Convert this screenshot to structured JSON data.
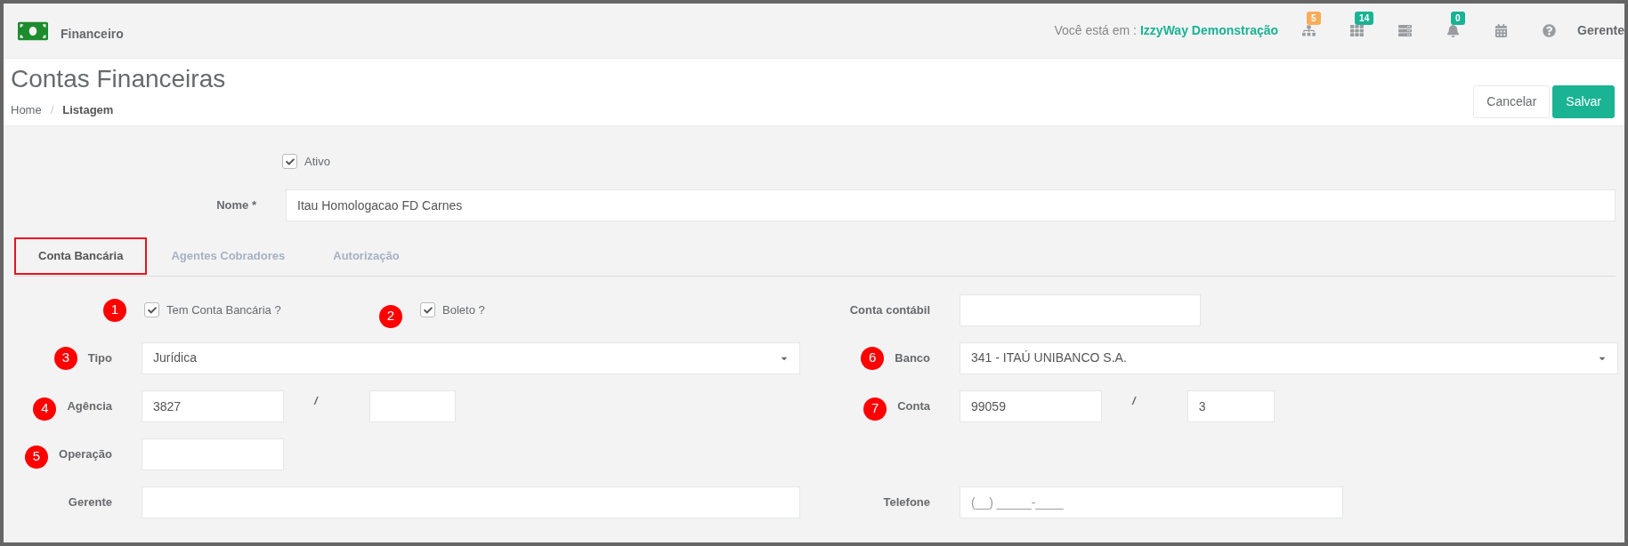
{
  "header": {
    "title": "Financeiro",
    "location_label": "Você está em :",
    "location": "IzzyWay Demonstração",
    "icons": [
      {
        "kind": "sitemap",
        "badge": "5",
        "color": "#f8ac59"
      },
      {
        "kind": "grid",
        "badge": "14",
        "color": "#1ab394"
      },
      {
        "kind": "server"
      },
      {
        "kind": "bell",
        "badge": "0",
        "color": "#1ab394"
      },
      {
        "kind": "calendar"
      },
      {
        "kind": "help"
      }
    ],
    "user": "Gerente"
  },
  "page": {
    "title": "Contas Financeiras",
    "breadcrumb": [
      "Home",
      "Listagem"
    ],
    "breadcrumb_separator": "/",
    "buttons": [
      {
        "label": "Cancelar",
        "kind": "default"
      },
      {
        "label": "Salvar",
        "kind": "primary"
      }
    ]
  },
  "form": {
    "active": {
      "label": "Ativo",
      "checked": true
    },
    "name": {
      "label": "Nome *",
      "value": "Itau Homologacao FD Carnes"
    }
  },
  "tabs": [
    {
      "label": "Conta Bancária",
      "selected": true,
      "highlighted": true
    },
    {
      "label": "Agentes Cobradores",
      "selected": false,
      "highlighted": false
    },
    {
      "label": "Autorização",
      "selected": false,
      "highlighted": false
    }
  ],
  "rows": [
    {
      "left": {
        "kind": "checks",
        "items": [
          {
            "marker": "1",
            "label": "Tem Conta Bancária ?",
            "checked": true
          },
          {
            "marker": "2",
            "label": "Boleto ?",
            "checked": true
          }
        ]
      },
      "right": {
        "kind": "medium",
        "label": "Conta contábil"
      }
    },
    {
      "left": {
        "kind": "select",
        "marker": "3",
        "label": "Tipo",
        "value": "Jurídica"
      },
      "right": {
        "kind": "select",
        "marker": "6",
        "label": "Banco",
        "value": "341 - ITAÚ UNIBANCO S.A."
      }
    },
    {
      "left": {
        "kind": "pair",
        "marker": "4",
        "label": "Agência",
        "value": "3827",
        "separator": "/"
      },
      "right": {
        "kind": "pair",
        "marker": "7",
        "label": "Conta",
        "value": "99059",
        "separator": "/",
        "value2": "3"
      }
    },
    {
      "left": {
        "kind": "short",
        "marker": "5",
        "label": "Operação"
      }
    },
    {
      "left": {
        "kind": "wide",
        "label": "Gerente"
      },
      "right": {
        "kind": "medium",
        "label": "Telefone",
        "placeholder": "(__) _____-____"
      }
    }
  ]
}
